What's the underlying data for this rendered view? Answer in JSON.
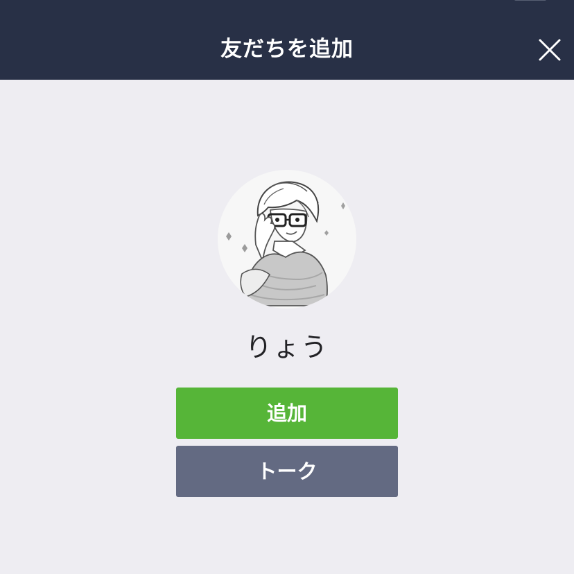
{
  "header": {
    "title": "友だちを追加",
    "status_left": "• •",
    "status_right": "",
    "close_icon": "close-icon"
  },
  "profile": {
    "name": "りょう",
    "avatar": "manga-style boy with glasses and gray sweater"
  },
  "buttons": {
    "add_label": "追加",
    "talk_label": "トーク"
  },
  "colors": {
    "header": "#283046",
    "background": "#eeedf2",
    "add_button": "#56b538",
    "talk_button": "#636a82",
    "text_dark": "#222226"
  }
}
